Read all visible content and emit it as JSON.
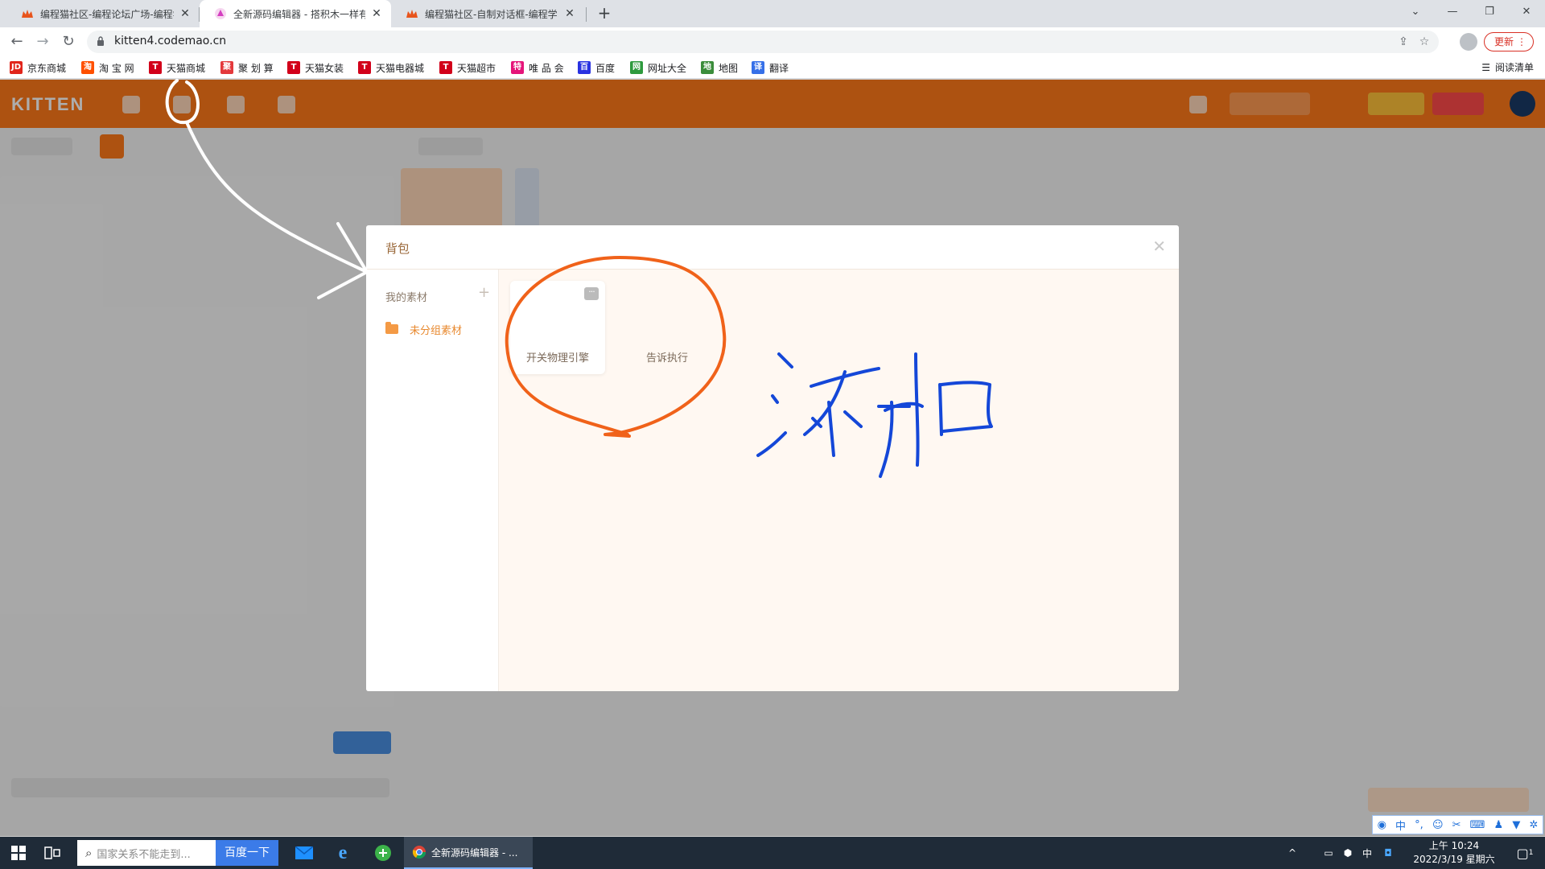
{
  "browser": {
    "tabs": [
      {
        "title": "编程猫社区-编程论坛广场-编程学",
        "active": false
      },
      {
        "title": "全新源码编辑器 - 搭积木一样有趣",
        "active": true
      },
      {
        "title": "编程猫社区-自制对话框-编程学习",
        "active": false
      }
    ],
    "new_tab_icon": "plus-icon",
    "url": "kitten4.codemao.cn",
    "update_label": "更新",
    "bookmarks": [
      {
        "label": "京东商城",
        "icon": "JD",
        "color": "#e1251b"
      },
      {
        "label": "淘 宝 网",
        "icon": "淘",
        "color": "#ff5000"
      },
      {
        "label": "天猫商城",
        "icon": "T",
        "color": "#d2001a"
      },
      {
        "label": "聚 划 算",
        "icon": "聚",
        "color": "#e4393c"
      },
      {
        "label": "天猫女装",
        "icon": "T",
        "color": "#d2001a"
      },
      {
        "label": "天猫电器城",
        "icon": "T",
        "color": "#d2001a"
      },
      {
        "label": "天猫超市",
        "icon": "T",
        "color": "#d2001a"
      },
      {
        "label": "唯 品 会",
        "icon": "特",
        "color": "#e5157a"
      },
      {
        "label": "百度",
        "icon": "百",
        "color": "#2932e1"
      },
      {
        "label": "网址大全",
        "icon": "网",
        "color": "#2e9a3e"
      },
      {
        "label": "地图",
        "icon": "地",
        "color": "#3b8d3b"
      },
      {
        "label": "翻译",
        "icon": "译",
        "color": "#3670e8"
      }
    ],
    "reading_list": "阅读清单"
  },
  "app": {
    "logo": "KITTEN",
    "accent": "#ff7a1a"
  },
  "modal": {
    "title": "背包",
    "close_icon": "close-icon",
    "sidebar": {
      "title": "我的素材",
      "add_icon": "plus-icon",
      "group_label": "未分组素材"
    },
    "assets": [
      {
        "name": "开关物理引擎",
        "more_icon": "more-icon"
      },
      {
        "name": "告诉执行"
      }
    ]
  },
  "annotation": {
    "handwritten_text": "添加",
    "colors": {
      "orange": "#f0621a",
      "blue": "#1447d8",
      "white": "#ffffff"
    }
  },
  "taskbar": {
    "search_placeholder": "国家关系不能走到...",
    "search_button": "百度一下",
    "chrome_task": "全新源码编辑器 - ...",
    "ime_indicator": "中",
    "clock_time": "上午 10:24",
    "clock_date": "2022/3/19 星期六",
    "notification_count": "1"
  },
  "ime_bar": {
    "mode": "中"
  }
}
